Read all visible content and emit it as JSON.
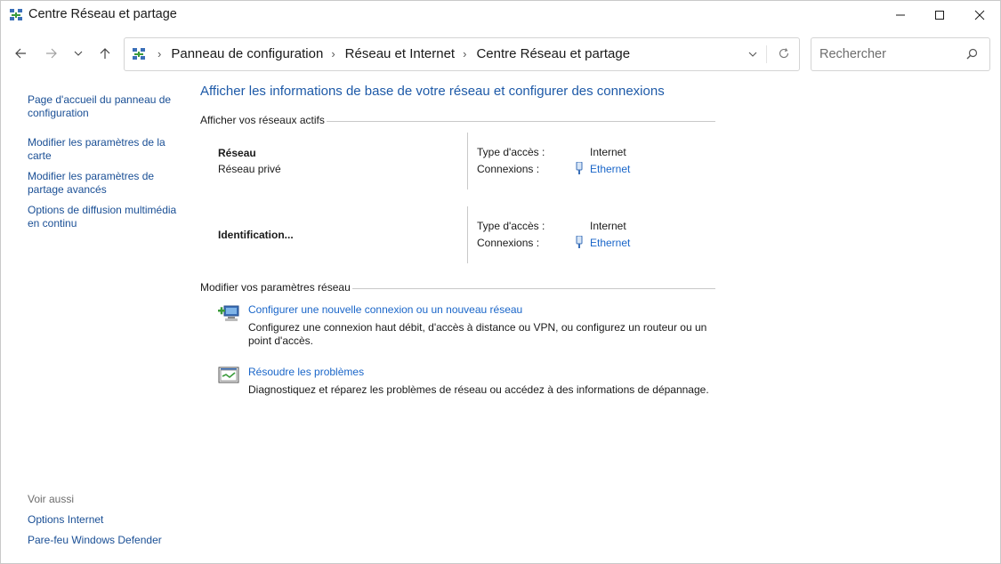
{
  "window": {
    "title": "Centre Réseau et partage"
  },
  "address_bar": {
    "breadcrumbs": [
      "Panneau de configuration",
      "Réseau et Internet",
      "Centre Réseau et partage"
    ]
  },
  "search": {
    "placeholder": "Rechercher"
  },
  "sidebar": {
    "links": [
      "Page d'accueil du panneau de configuration",
      "Modifier les paramètres de la carte",
      "Modifier les paramètres de partage avancés",
      "Options de diffusion multimédia en continu"
    ],
    "see_also_label": "Voir aussi",
    "see_also": [
      "Options Internet",
      "Pare-feu Windows Defender"
    ]
  },
  "main": {
    "title": "Afficher les informations de base de votre réseau et configurer des connexions",
    "active_networks_heading": "Afficher vos réseaux actifs",
    "networks": [
      {
        "name": "Réseau",
        "category": "Réseau privé",
        "access_label": "Type d'accès :",
        "access_value": "Internet",
        "connections_label": "Connexions :",
        "connection": "Ethernet"
      },
      {
        "name": "Identification...",
        "category": "",
        "access_label": "Type d'accès :",
        "access_value": "Internet",
        "connections_label": "Connexions :",
        "connection": "Ethernet"
      }
    ],
    "change_settings_heading": "Modifier vos paramètres réseau",
    "tasks": [
      {
        "link": "Configurer une nouvelle connexion ou un nouveau réseau",
        "description": "Configurez une connexion haut débit, d'accès à distance ou VPN, ou configurez un routeur ou un point d'accès."
      },
      {
        "link": "Résoudre les problèmes",
        "description": "Diagnostiquez et réparez les problèmes de réseau ou accédez à des informations de dépannage."
      }
    ]
  },
  "colors": {
    "link": "#1a66c9",
    "title": "#1e5aa8",
    "side_link": "#1a4f95"
  }
}
